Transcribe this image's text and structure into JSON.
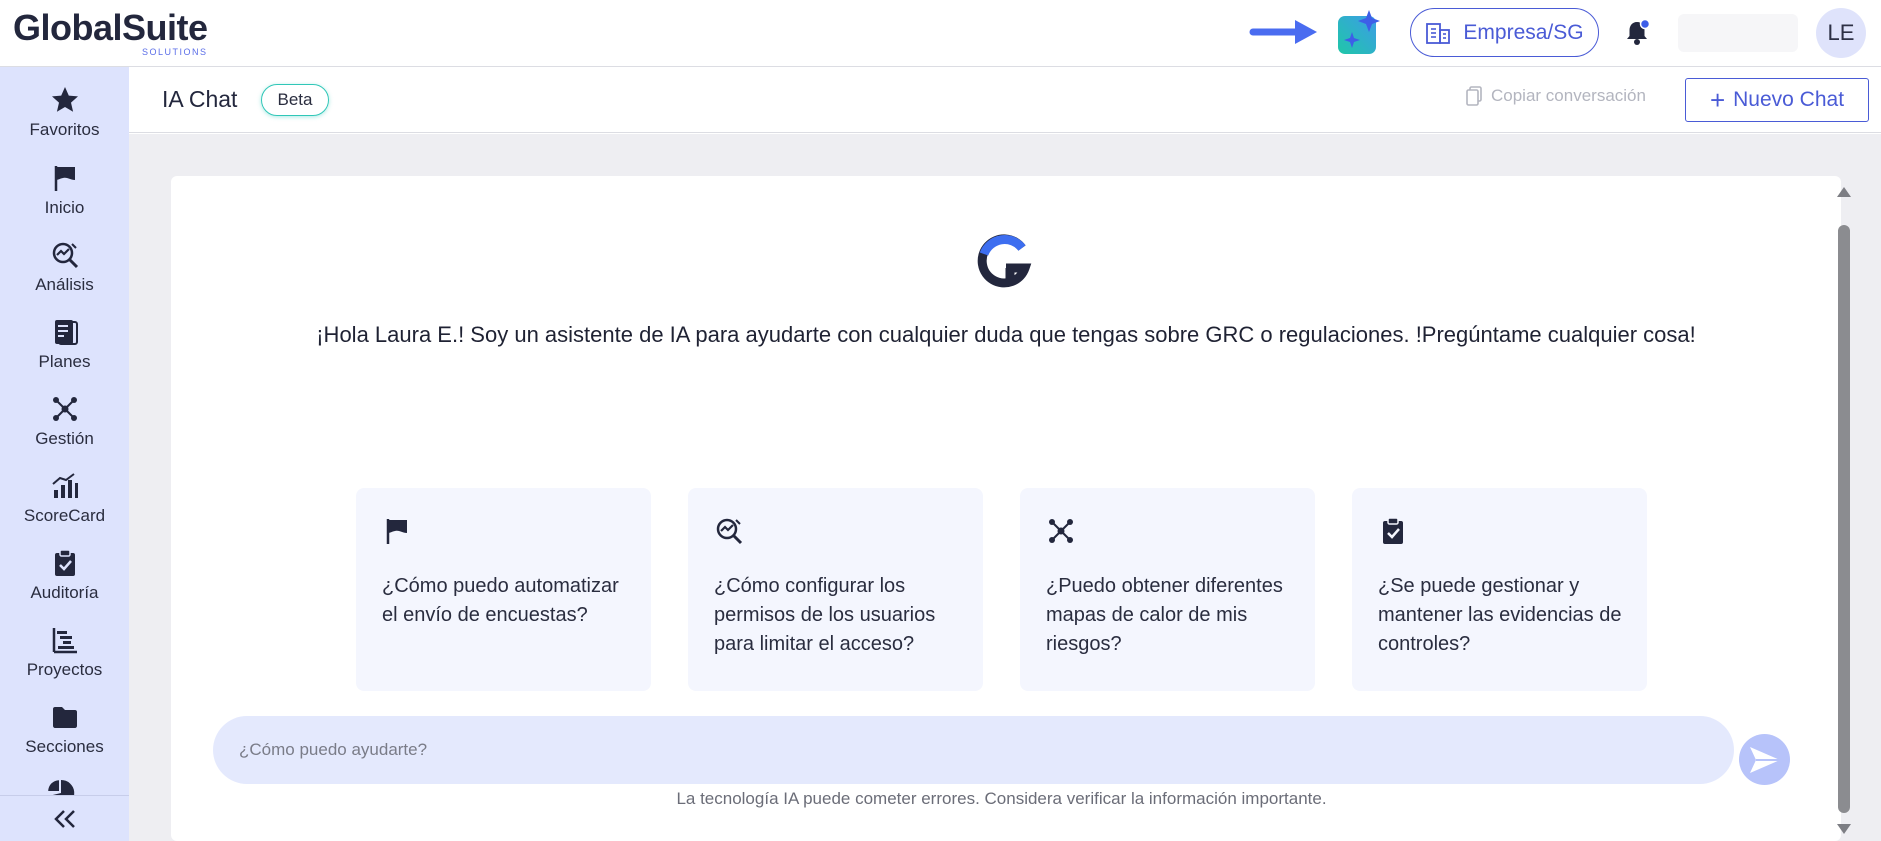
{
  "app": {
    "logo_text": "GlobalSuite",
    "logo_sub": "SOLUTIONS"
  },
  "topbar": {
    "company_label": "Empresa/SG",
    "avatar_initials": "LE",
    "ai_icon": "sparkle-icon",
    "notification_icon": "bell-icon"
  },
  "sidebar": {
    "items": [
      {
        "label": "Favoritos",
        "icon": "star-icon"
      },
      {
        "label": "Inicio",
        "icon": "flag-icon"
      },
      {
        "label": "Análisis",
        "icon": "analysis-icon"
      },
      {
        "label": "Planes",
        "icon": "plans-icon"
      },
      {
        "label": "Gestión",
        "icon": "network-icon"
      },
      {
        "label": "ScoreCard",
        "icon": "bar-chart-icon"
      },
      {
        "label": "Auditoría",
        "icon": "clipboard-check-icon"
      },
      {
        "label": "Proyectos",
        "icon": "gantt-icon"
      },
      {
        "label": "Secciones",
        "icon": "folder-icon"
      }
    ]
  },
  "header": {
    "title": "IA Chat",
    "badge": "Beta",
    "copy_label": "Copiar conversación",
    "new_chat_label": "Nuevo Chat"
  },
  "chat": {
    "greeting": "¡Hola Laura E.! Soy un asistente de IA para ayudarte con cualquier duda que tengas sobre GRC o regulaciones. !Pregúntame cualquier cosa!",
    "suggestions": [
      {
        "text": "¿Cómo puedo automatizar el envío de encuestas?",
        "icon": "flag-icon"
      },
      {
        "text": "¿Cómo configurar los permisos de los usuarios para limitar el acceso?",
        "icon": "analysis-icon"
      },
      {
        "text": "¿Puedo obtener diferentes mapas de calor de mis riesgos?",
        "icon": "network-icon"
      },
      {
        "text": "¿Se puede gestionar y mantener las evidencias de controles?",
        "icon": "clipboard-check-icon"
      }
    ],
    "input_placeholder": "¿Cómo puedo ayudarte?",
    "disclaimer": "La tecnología IA puede cometer errores. Considera verificar la información importante."
  },
  "colors": {
    "accent": "#4a5bd6",
    "sidebar_bg": "#dde3fd",
    "beta_border": "#30c7b8",
    "ai_gradient_start": "#1fc7a8",
    "ai_gradient_end": "#3d5ee8"
  }
}
